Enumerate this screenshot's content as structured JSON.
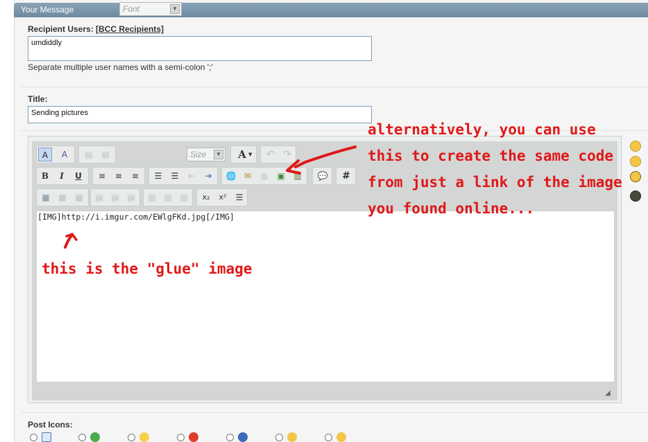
{
  "panel": {
    "title": "Your Message"
  },
  "recipients": {
    "label": "Recipient Users:",
    "bcc_link": "[BCC Recipients]",
    "value": "umdiddly",
    "hint": "Separate multiple user names with a semi-colon ';'"
  },
  "title_field": {
    "label": "Title:",
    "value": "Sending pictures"
  },
  "toolbar": {
    "font_placeholder": "Font",
    "size_placeholder": "Size",
    "bold": "B",
    "italic": "I",
    "underline": "U",
    "text_color": "A",
    "code_hash": "#",
    "subscript": "x₂",
    "superscript": "x²"
  },
  "editor": {
    "content": "[IMG]http://i.imgur.com/EWlgFKd.jpg[/IMG]"
  },
  "annotations": {
    "right_line1": "alternatively, you can use",
    "right_line2": "this to create the same code",
    "right_line3": "from just a link of the image",
    "right_line4": "you found online...",
    "below": "this is the \"glue\" image"
  },
  "post_icons": {
    "label": "Post Icons:"
  },
  "colors": {
    "annotation": "#e01818",
    "titlebar": "#7792a8",
    "panel": "#f4f5f4"
  }
}
